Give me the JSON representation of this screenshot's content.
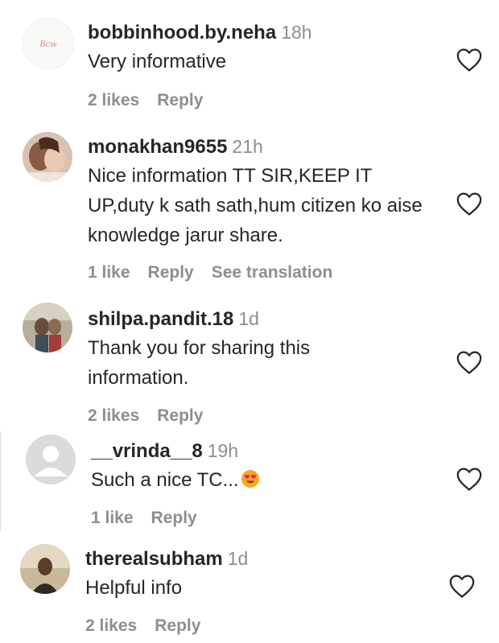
{
  "comments": [
    {
      "username": "bobbinhood.by.neha",
      "time": "18h",
      "text": "Very informative",
      "likes": "2 likes",
      "reply": "Reply",
      "avatar_text": "Bcw"
    },
    {
      "username": "monakhan9655",
      "time": "21h",
      "text": "Nice information TT SIR,KEEP IT UP,duty k sath sath,hum citizen ko aise knowledge jarur share.",
      "likes": "1 like",
      "reply": "Reply",
      "translate": "See translation"
    },
    {
      "username": "shilpa.pandit.18",
      "time": "1d",
      "text": "Thank you for sharing this information.",
      "likes": "2 likes",
      "reply": "Reply"
    },
    {
      "username": "__vrinda__8",
      "time": "19h",
      "text": "Such a nice TC...",
      "emoji": "smiling-face-with-heart-eyes",
      "likes": "1 like",
      "reply": "Reply"
    },
    {
      "username": "therealsubham",
      "time": "1d",
      "text": "Helpful info",
      "likes": "2 likes",
      "reply": "Reply"
    }
  ],
  "icons": {
    "like": "heart-outline-icon"
  },
  "colors": {
    "text": "#262626",
    "muted": "#8e8e8e",
    "background": "#ffffff"
  }
}
